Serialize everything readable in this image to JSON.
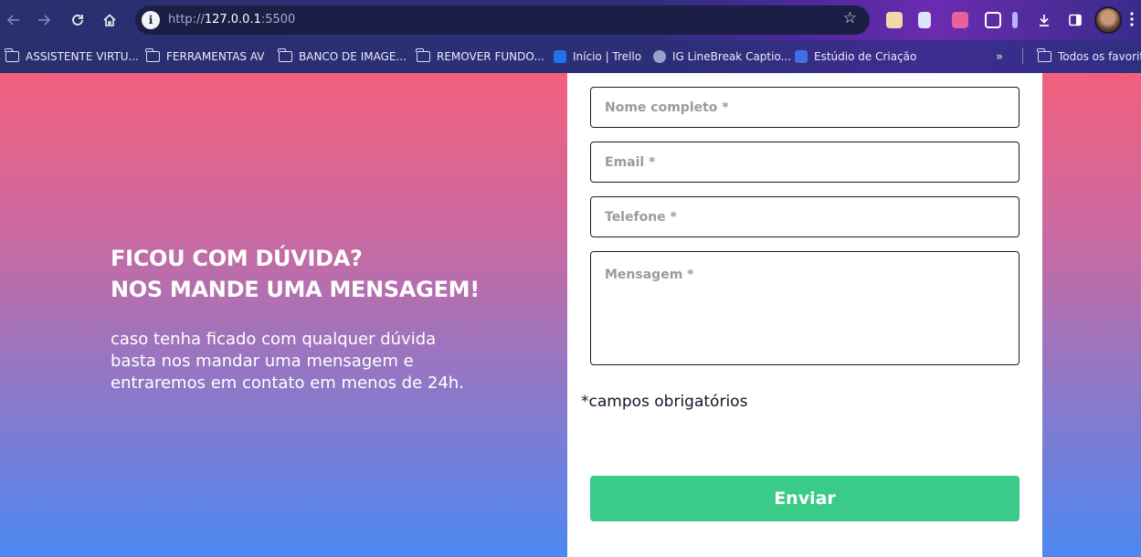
{
  "browser": {
    "url_prefix": "http://",
    "url_host": "127.0.0.1",
    "url_port": ":5500",
    "bookmarks": [
      {
        "label": "ASSISTENTE VIRTU...",
        "icon": "folder-icon"
      },
      {
        "label": "FERRAMENTAS AV",
        "icon": "folder-icon"
      },
      {
        "label": "BANCO DE IMAGE...",
        "icon": "folder-icon"
      },
      {
        "label": "REMOVER FUNDO...",
        "icon": "folder-icon"
      },
      {
        "label": "Início | Trello",
        "icon": "trello-icon"
      },
      {
        "label": "IG LineBreak Captio...",
        "icon": "globe-icon"
      },
      {
        "label": "Estúdio de Criação",
        "icon": "studio-icon"
      },
      {
        "label": "Todos os favoritos",
        "icon": "folder-icon"
      }
    ],
    "colors": {
      "accent": "#3acb88"
    }
  },
  "contact": {
    "title_line1": "FICOU COM DÚVIDA?",
    "title_line2": "NOS MANDE UMA MENSAGEM!",
    "description": "caso tenha ficado com qualquer dúvida basta nos mandar uma mensagem e entraremos em contato em menos de 24h."
  },
  "form": {
    "name_placeholder": "Nome completo *",
    "email_placeholder": "Email *",
    "phone_placeholder": "Telefone *",
    "message_placeholder": "Mensagem *",
    "required_note": "*campos obrigatórios",
    "submit_label": "Enviar"
  }
}
